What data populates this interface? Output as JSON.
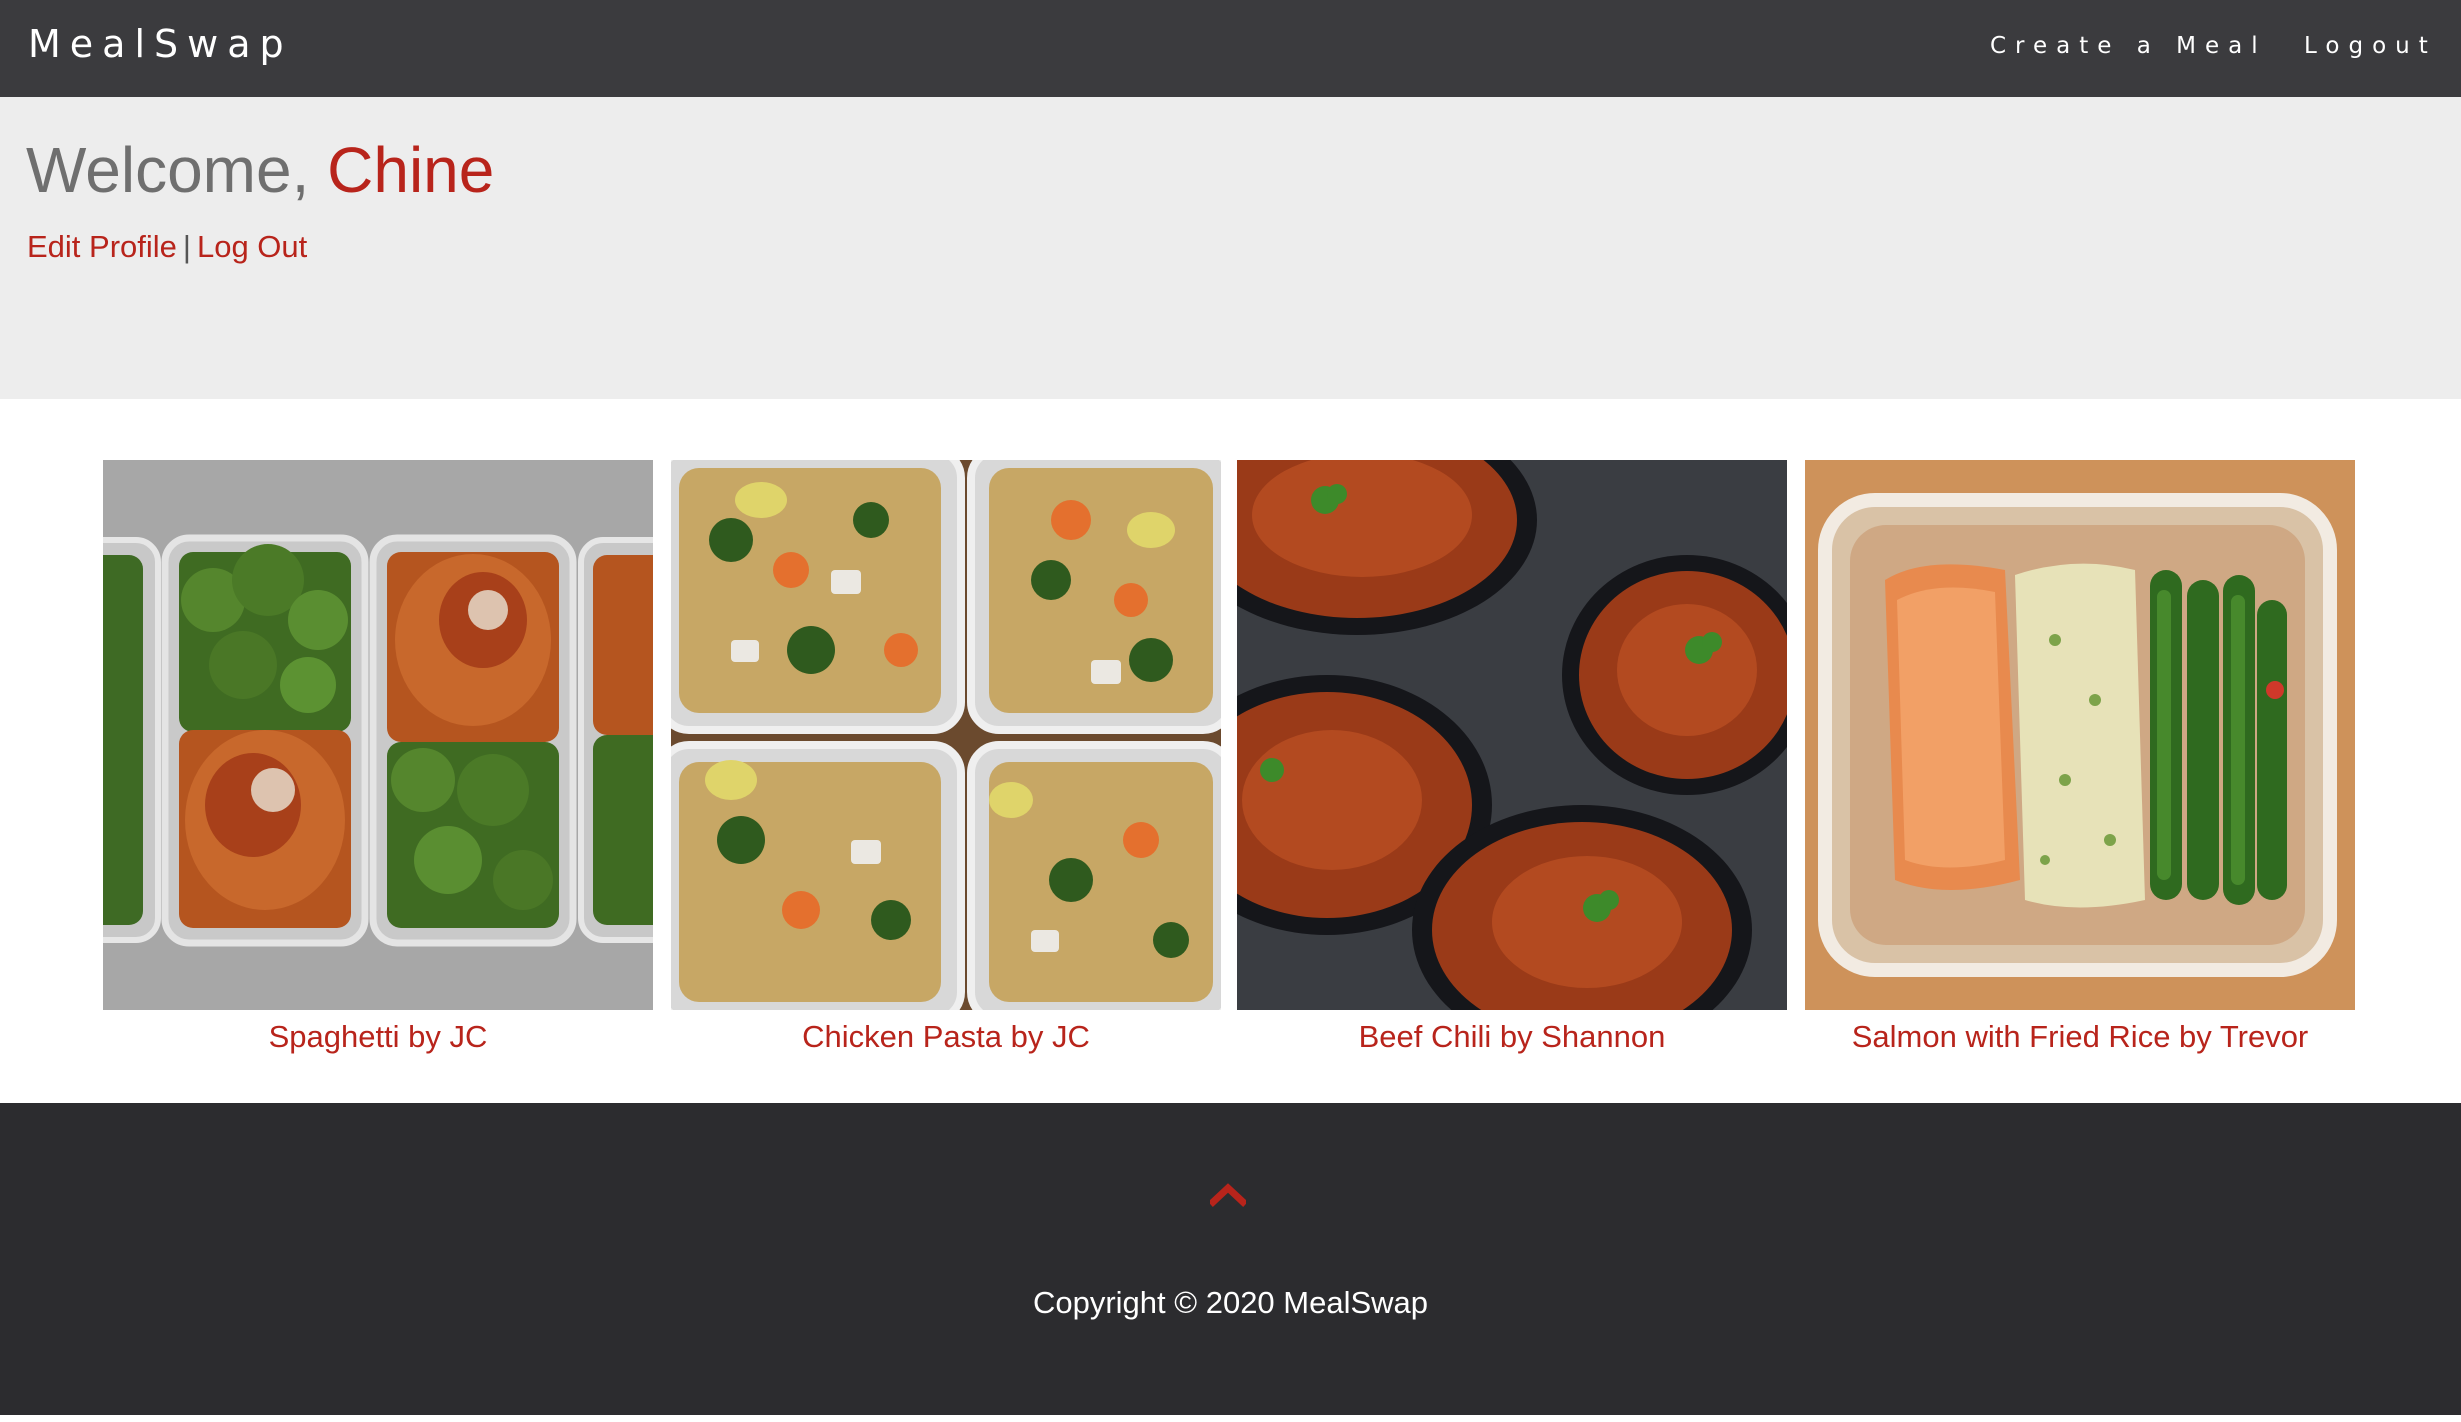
{
  "navbar": {
    "brand": "MealSwap",
    "links": {
      "create": "Create a Meal",
      "logout": "Logout"
    }
  },
  "welcome": {
    "greeting": "Welcome,",
    "name": "Chine",
    "edit_profile": "Edit Profile",
    "separator": "|",
    "log_out": "Log Out"
  },
  "meals": [
    {
      "caption": "Spaghetti by JC",
      "image": "spaghetti-meal-prep-photo"
    },
    {
      "caption": "Chicken Pasta by JC",
      "image": "chicken-pasta-meal-prep-photo"
    },
    {
      "caption": "Beef Chili by Shannon",
      "image": "beef-chili-bowls-photo"
    },
    {
      "caption": "Salmon with Fried Rice by Trevor",
      "image": "salmon-fried-rice-photo"
    }
  ],
  "footer": {
    "scroll_top_icon": "chevron-up-icon",
    "copyright": "Copyright © 2020 MealSwap"
  },
  "colors": {
    "navbar_bg": "#3b3b3e",
    "welcome_bg": "#ededed",
    "accent": "#b8241b",
    "footer_bg": "#2c2c2f"
  }
}
